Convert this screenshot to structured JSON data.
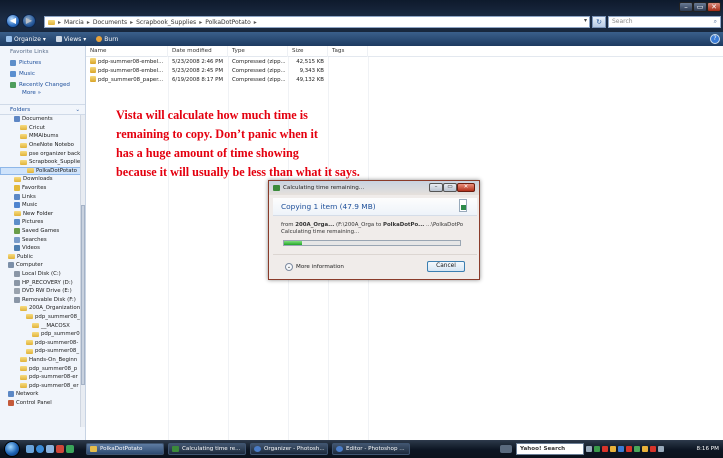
{
  "address": {
    "crumbs": [
      "Marcia",
      "Documents",
      "Scrapbook_Supplies",
      "PolkaDotPotato"
    ],
    "separator": "▸",
    "search_placeholder": "Search"
  },
  "toolbar": {
    "organize": "Organize",
    "views": "Views",
    "burn": "Burn"
  },
  "nav": {
    "favorite_links_header": "Favorite Links",
    "favorites": [
      "Pictures",
      "Music",
      "Recently Changed"
    ],
    "more": "More »",
    "folders_header": "Folders",
    "tree": [
      {
        "label": "Documents",
        "indent": 0,
        "kind": "doc"
      },
      {
        "label": "Cricut",
        "indent": 1,
        "kind": "folder"
      },
      {
        "label": "MMAlbums",
        "indent": 1,
        "kind": "folder"
      },
      {
        "label": "OneNote Notebo",
        "indent": 1,
        "kind": "folder"
      },
      {
        "label": "pse organizer back",
        "indent": 1,
        "kind": "folder"
      },
      {
        "label": "Scrapbook_Supplie",
        "indent": 1,
        "kind": "folder"
      },
      {
        "label": "PolkaDotPotato",
        "indent": 2,
        "kind": "folder",
        "selected": true
      },
      {
        "label": "Downloads",
        "indent": 0,
        "kind": "folder"
      },
      {
        "label": "Favorites",
        "indent": 0,
        "kind": "fav"
      },
      {
        "label": "Links",
        "indent": 0,
        "kind": "link"
      },
      {
        "label": "Music",
        "indent": 0,
        "kind": "music"
      },
      {
        "label": "New Folder",
        "indent": 0,
        "kind": "folder"
      },
      {
        "label": "Pictures",
        "indent": 0,
        "kind": "pic"
      },
      {
        "label": "Saved Games",
        "indent": 0,
        "kind": "game"
      },
      {
        "label": "Searches",
        "indent": 0,
        "kind": "search"
      },
      {
        "label": "Videos",
        "indent": 0,
        "kind": "video"
      },
      {
        "label": "Public",
        "indent": -1,
        "kind": "folder"
      },
      {
        "label": "Computer",
        "indent": -1,
        "kind": "computer"
      },
      {
        "label": "Local Disk (C:)",
        "indent": 0,
        "kind": "disk"
      },
      {
        "label": "HP_RECOVERY (D:)",
        "indent": 0,
        "kind": "disk"
      },
      {
        "label": "DVD RW Drive (E:)",
        "indent": 0,
        "kind": "dvd"
      },
      {
        "label": "Removable Disk (F:)",
        "indent": 0,
        "kind": "disk"
      },
      {
        "label": "200A_Organization",
        "indent": 1,
        "kind": "folder"
      },
      {
        "label": "pdp_summer08_",
        "indent": 2,
        "kind": "folder"
      },
      {
        "label": "__MACOSX",
        "indent": 3,
        "kind": "folder"
      },
      {
        "label": "pdp_summer0",
        "indent": 3,
        "kind": "folder"
      },
      {
        "label": "pdp-summer08-",
        "indent": 2,
        "kind": "folder"
      },
      {
        "label": "pdp-summer08_",
        "indent": 2,
        "kind": "folder"
      },
      {
        "label": "Hands-On_Beginn",
        "indent": 1,
        "kind": "folder"
      },
      {
        "label": "pdp_summer08_p",
        "indent": 1,
        "kind": "folder"
      },
      {
        "label": "pdp-summer08-er",
        "indent": 1,
        "kind": "folder"
      },
      {
        "label": "pdp-summer08_er",
        "indent": 1,
        "kind": "folder"
      },
      {
        "label": "Network",
        "indent": -1,
        "kind": "network"
      },
      {
        "label": "Control Panel",
        "indent": -1,
        "kind": "cp"
      }
    ]
  },
  "files": {
    "columns": [
      "Name",
      "Date modified",
      "Type",
      "Size",
      "Tags"
    ],
    "rows": [
      {
        "name": "pdp-summer08-embel...",
        "date": "5/23/2008 2:46 PM",
        "type": "Compressed (zipp...",
        "size": "42,515 KB"
      },
      {
        "name": "pdp-summer08-embel...",
        "date": "5/23/2008 2:45 PM",
        "type": "Compressed (zipp...",
        "size": "9,343 KB"
      },
      {
        "name": "pdp_summer08_paper...",
        "date": "6/19/2008 8:17 PM",
        "type": "Compressed (zipp...",
        "size": "49,132 KB"
      }
    ]
  },
  "annotation": {
    "lines": [
      "Vista will calculate how much time is",
      "remaining to copy. Don’t panic when it",
      "has a huge amount of time showing",
      "because it will usually be less than what it says."
    ]
  },
  "dialog": {
    "title": "Calculating time remaining...",
    "heading": "Copying 1 item (47.9 MB)",
    "from_label": "from",
    "from_source": "200A_Orga...",
    "from_source_path": "(F:\\200A_Orga to",
    "to_dest": "PolkaDotPo...",
    "to_dest_path": "...\\PolkaDotPo",
    "status": "Calculating time remaining...",
    "progress": 0.1,
    "more_info": "More information",
    "cancel": "Cancel"
  },
  "taskbar": {
    "tasks": [
      "PolkaDotPotato",
      "Calculating time re...",
      "Organizer - Photosh...",
      "Editor - Photoshop ..."
    ],
    "search": "Yahoo! Search",
    "clock": "8:16 PM"
  }
}
